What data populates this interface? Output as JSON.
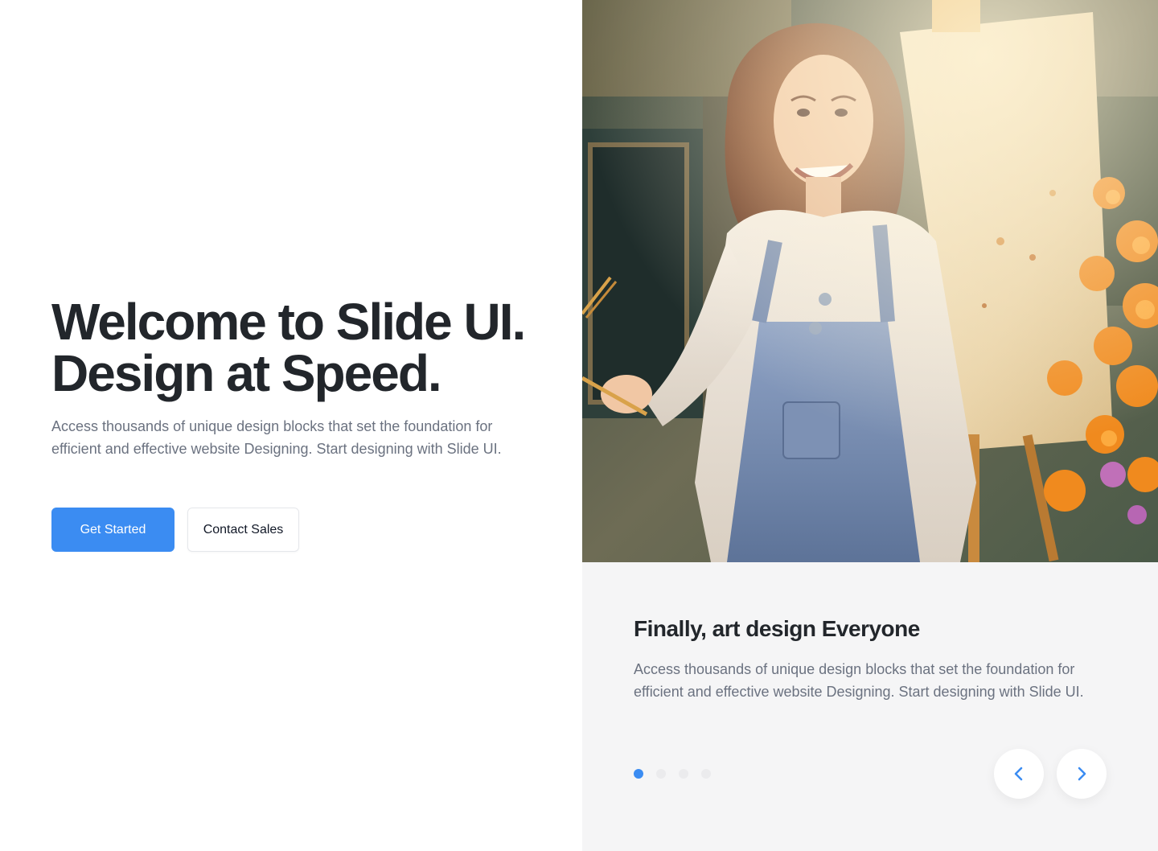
{
  "hero": {
    "title_line1": "Welcome to Slide UI.",
    "title_line2": "Design at Speed.",
    "description": "Access thousands of unique design blocks that set the foundation for efficient and effective website Designing. Start designing with Slide UI.",
    "primary_button": "Get Started",
    "secondary_button": "Contact Sales"
  },
  "slider": {
    "image_alt_icon": "painter-photo",
    "title": "Finally, art design Everyone",
    "description": "Access thousands of unique design blocks that set the foundation for efficient and effective website Designing. Start designing with Slide UI.",
    "slide_count": 4,
    "active_slide": 1,
    "prev_icon": "chevron-left-icon",
    "next_icon": "chevron-right-icon"
  },
  "colors": {
    "accent": "#3b8cf2",
    "title_text": "#22262b",
    "body_text": "#6b7280",
    "panel_bg": "#f5f5f6"
  }
}
